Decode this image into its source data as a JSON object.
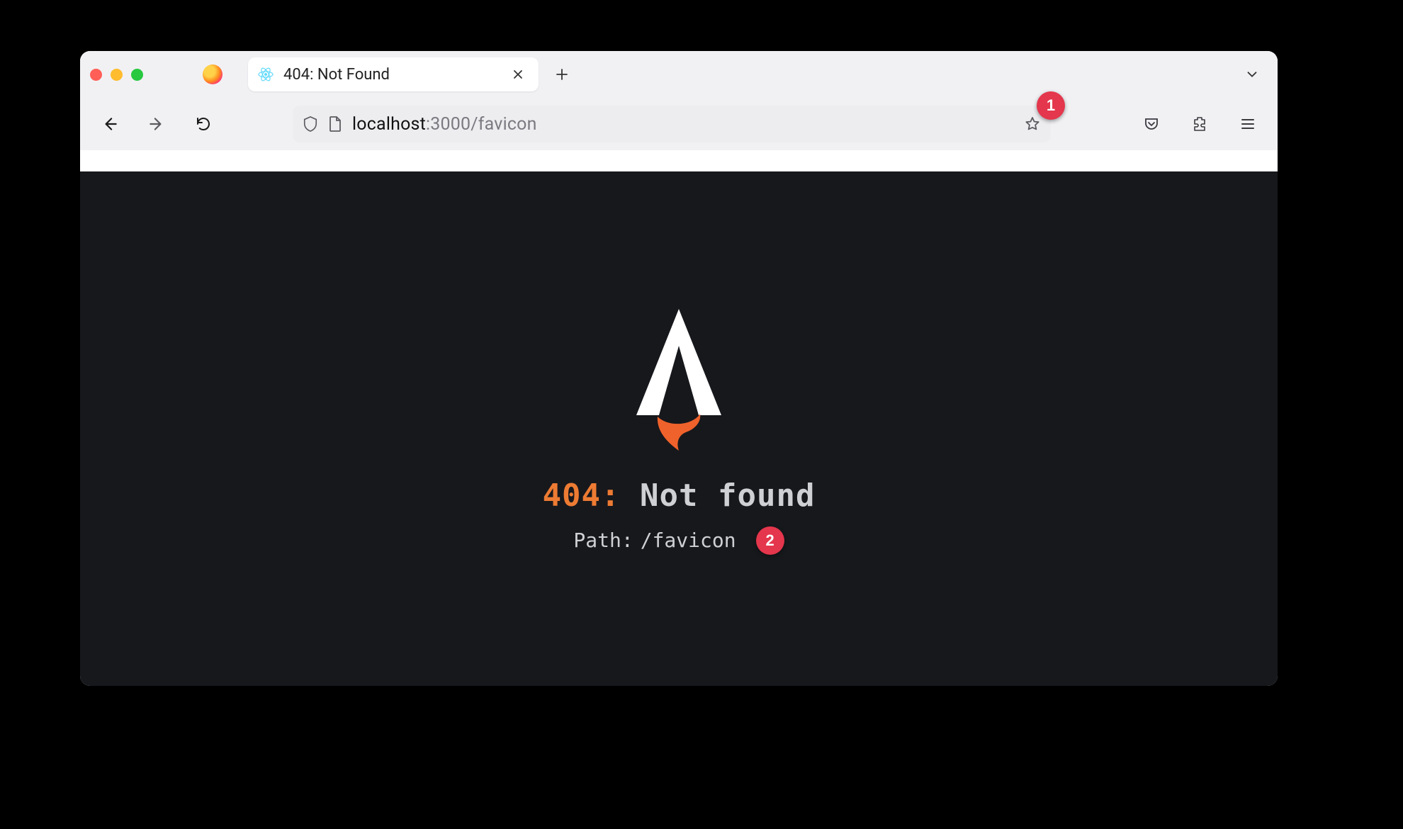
{
  "browser": {
    "tab": {
      "title": "404: Not Found"
    },
    "url": {
      "host": "localhost",
      "rest": ":3000/favicon"
    }
  },
  "page": {
    "error_code": "404:",
    "error_message": " Not found",
    "path_label": "Path:",
    "path_value": "/favicon"
  },
  "annotations": {
    "one": "1",
    "two": "2"
  }
}
